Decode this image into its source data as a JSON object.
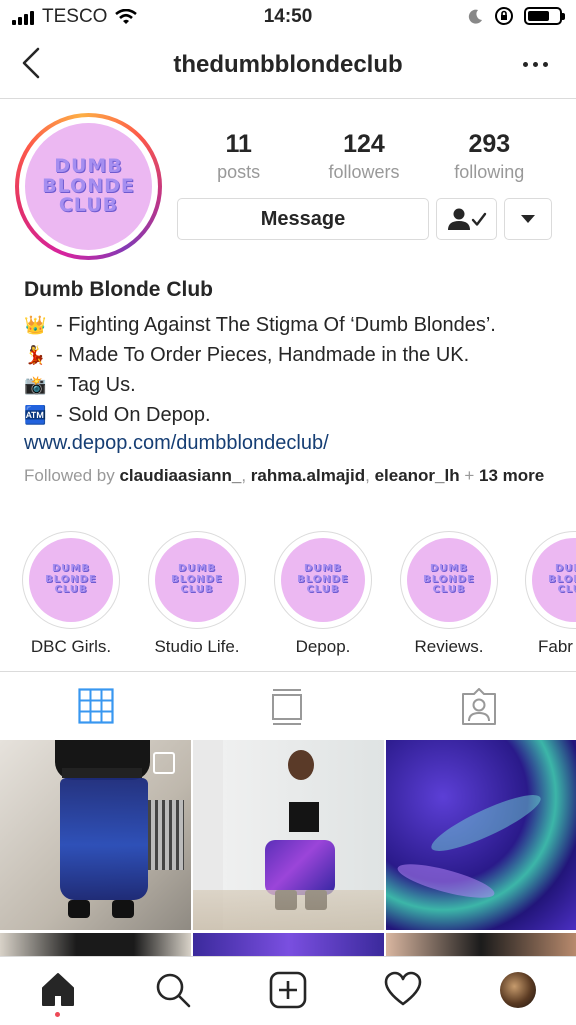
{
  "status_bar": {
    "carrier": "TESCO",
    "time": "14:50",
    "battery_level": 0.7
  },
  "nav": {
    "title": "thedumbblondeclub"
  },
  "profile": {
    "logo_text": [
      "DUMB",
      "BLONDE",
      "CLUB"
    ],
    "stats": [
      {
        "num": "11",
        "label": "posts"
      },
      {
        "num": "124",
        "label": "followers"
      },
      {
        "num": "293",
        "label": "following"
      }
    ],
    "message_label": "Message"
  },
  "bio": {
    "name": "Dumb Blonde Club",
    "lines": [
      {
        "emoji": "👑",
        "text": "- Fighting Against The Stigma Of ‘Dumb Blondes’."
      },
      {
        "emoji": "💃",
        "text": "- Made To Order Pieces, Handmade in the UK."
      },
      {
        "emoji": "📸",
        "text": "- Tag Us."
      },
      {
        "emoji": "🏧",
        "text": "- Sold On Depop."
      }
    ],
    "link": "www.depop.com/dumbblondeclub/",
    "followed_prefix": "Followed by ",
    "followed_users": [
      "claudiaasiann_",
      "rahma.almajid",
      "eleanor_lh"
    ],
    "followed_sep": ", ",
    "followed_plus": " + ",
    "followed_more": "13 more"
  },
  "highlights": [
    {
      "label": "DBC Girls."
    },
    {
      "label": "Studio Life."
    },
    {
      "label": "Depop."
    },
    {
      "label": "Reviews."
    },
    {
      "label": "Fabr"
    }
  ],
  "colors": {
    "accent": "#3897f0",
    "link": "#163e74",
    "logo_bg": "#ecb8f2",
    "logo_text": "#a58ef0",
    "notification": "#ed4956"
  }
}
